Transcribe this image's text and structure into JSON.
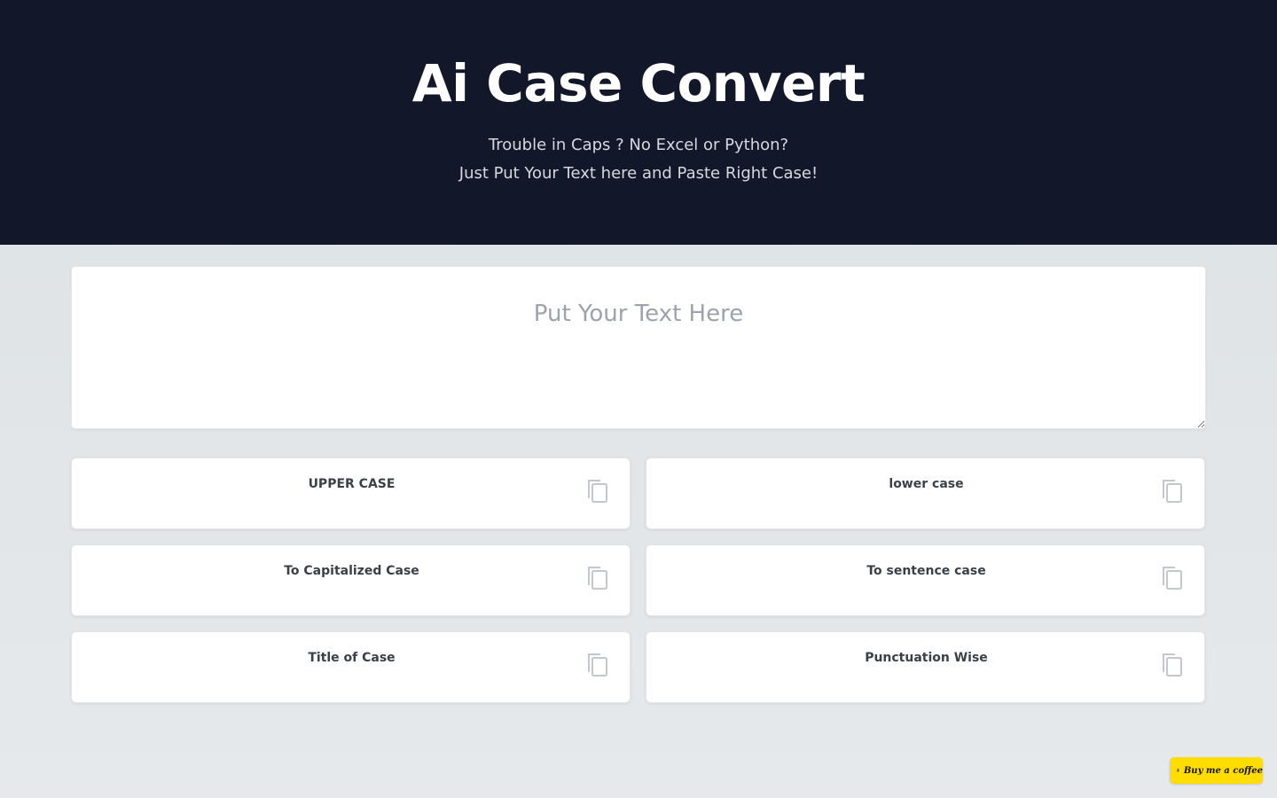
{
  "header": {
    "title": "Ai Case Convert",
    "subtitle_line1": "Trouble in Caps ? No Excel or Python?",
    "subtitle_line2": "Just Put Your Text here and Paste Right Case!"
  },
  "input": {
    "placeholder": "Put Your Text Here",
    "value": ""
  },
  "cards": [
    {
      "label": "UPPER CASE",
      "icon": "copy-icon"
    },
    {
      "label": "lower case",
      "icon": "copy-icon"
    },
    {
      "label": "To Capitalized Case",
      "icon": "copy-icon"
    },
    {
      "label": "To sentence case",
      "icon": "copy-icon"
    },
    {
      "label": "Title of Case",
      "icon": "copy-icon"
    },
    {
      "label": "Punctuation Wise",
      "icon": "copy-icon"
    }
  ],
  "buy_me_coffee": {
    "label": "Buy me a coffee",
    "icon": "coffee-cup-icon",
    "color": "#ffdd00"
  },
  "colors": {
    "header_bg": "#121829",
    "page_bg": "#e2e6e8"
  }
}
